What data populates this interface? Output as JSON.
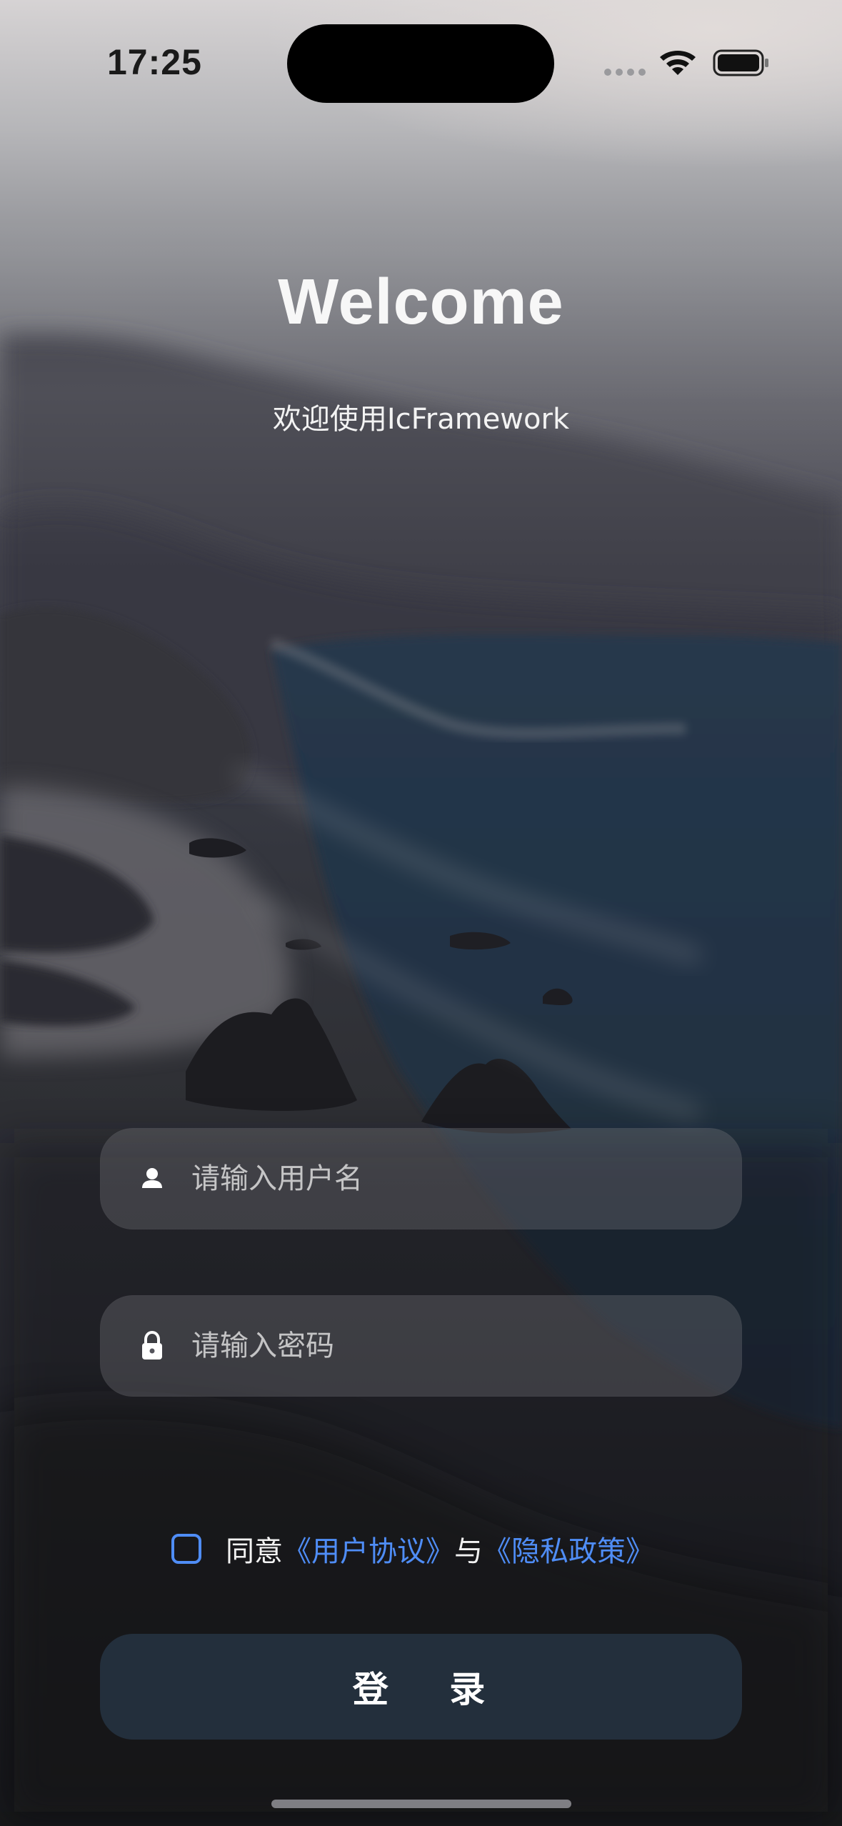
{
  "status_bar": {
    "time": "17:25"
  },
  "header": {
    "title": "Welcome",
    "subtitle": "欢迎使用IcFramework"
  },
  "form": {
    "username": {
      "placeholder": "请输入用户名",
      "value": "",
      "icon": "person-icon"
    },
    "password": {
      "placeholder": "请输入密码",
      "value": "",
      "icon": "lock-icon"
    }
  },
  "agreement": {
    "prefix": "同意",
    "user_agreement": "《用户协议》",
    "connector": "与",
    "privacy_policy": "《隐私政策》",
    "checked": false
  },
  "actions": {
    "login_label": "登 录"
  },
  "colors": {
    "accent": "#4f8df6",
    "button_bg": "#232f3c",
    "field_bg": "#5a5a62"
  }
}
